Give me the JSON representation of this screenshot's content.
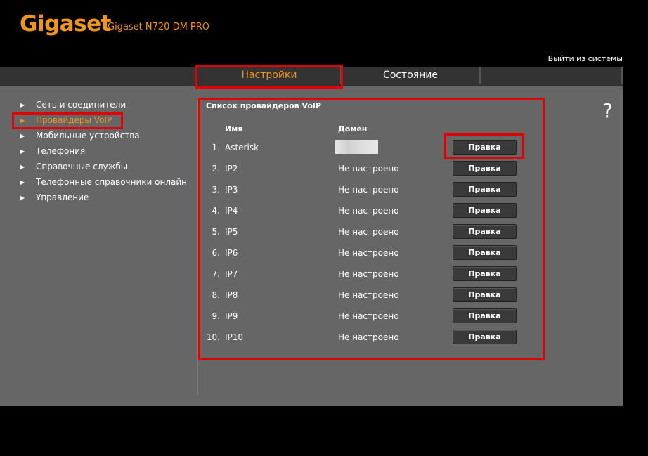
{
  "header": {
    "logo": "Gigaset",
    "model": "Gigaset N720 DM PRO",
    "logout": "Выйти из системы"
  },
  "tabs": [
    {
      "label": "Настройки",
      "active": true
    },
    {
      "label": "Состояние",
      "active": false
    }
  ],
  "nav": [
    {
      "label": "Сеть и соединители"
    },
    {
      "label": "Провайдеры VoIP",
      "active": true
    },
    {
      "label": "Мобильные устройства"
    },
    {
      "label": "Телефония"
    },
    {
      "label": "Справочные службы"
    },
    {
      "label": "Телефонные справочники онлайн"
    },
    {
      "label": "Управление"
    }
  ],
  "help_icon": "?",
  "main": {
    "title": "Список провайдеров VoIP",
    "col_name": "Имя",
    "col_domain": "Домен",
    "rows": [
      {
        "num": "1.",
        "name": "Asterisk",
        "domain": "",
        "button": "Правка"
      },
      {
        "num": "2.",
        "name": "IP2",
        "domain": "Не настроено",
        "button": "Правка"
      },
      {
        "num": "3.",
        "name": "IP3",
        "domain": "Не настроено",
        "button": "Правка"
      },
      {
        "num": "4.",
        "name": "IP4",
        "domain": "Не настроено",
        "button": "Правка"
      },
      {
        "num": "5.",
        "name": "IP5",
        "domain": "Не настроено",
        "button": "Правка"
      },
      {
        "num": "6.",
        "name": "IP6",
        "domain": "Не настроено",
        "button": "Правка"
      },
      {
        "num": "7.",
        "name": "IP7",
        "domain": "Не настроено",
        "button": "Правка"
      },
      {
        "num": "8.",
        "name": "IP8",
        "domain": "Не настроено",
        "button": "Правка"
      },
      {
        "num": "9.",
        "name": "IP9",
        "domain": "Не настроено",
        "button": "Правка"
      },
      {
        "num": "10.",
        "name": "IP10",
        "domain": "Не настроено",
        "button": "Правка"
      }
    ]
  },
  "colors": {
    "accent": "#f0961e",
    "highlight": "#e00000",
    "panel": "#666666",
    "tabbar": "#333333"
  }
}
